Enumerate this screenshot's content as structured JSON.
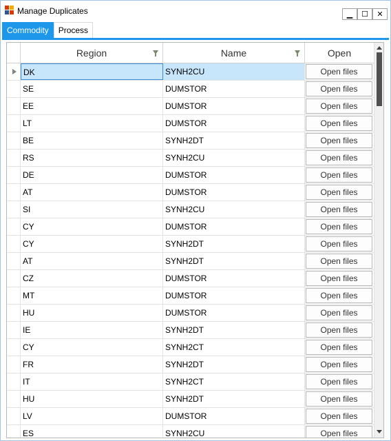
{
  "window": {
    "title": "Manage Duplicates",
    "minimize_glyph": "▁",
    "maximize_glyph": "☐",
    "close_glyph": "✕"
  },
  "tabs": [
    {
      "label": "Commodity",
      "active": true
    },
    {
      "label": "Process",
      "active": false
    }
  ],
  "colors": {
    "accent": "#1c97ea",
    "selected_row": "#c8e6fb"
  },
  "grid": {
    "columns": {
      "region": "Region",
      "name": "Name",
      "open": "Open"
    },
    "button_label": "Open files",
    "selected_index": 0,
    "rows": [
      {
        "region": "DK",
        "name": "SYNH2CU"
      },
      {
        "region": "SE",
        "name": "DUMSTOR"
      },
      {
        "region": "EE",
        "name": "DUMSTOR"
      },
      {
        "region": "LT",
        "name": "DUMSTOR"
      },
      {
        "region": "BE",
        "name": "SYNH2DT"
      },
      {
        "region": "RS",
        "name": "SYNH2CU"
      },
      {
        "region": "DE",
        "name": "DUMSTOR"
      },
      {
        "region": "AT",
        "name": "DUMSTOR"
      },
      {
        "region": "SI",
        "name": "SYNH2CU"
      },
      {
        "region": "CY",
        "name": "DUMSTOR"
      },
      {
        "region": "CY",
        "name": "SYNH2DT"
      },
      {
        "region": "AT",
        "name": "SYNH2DT"
      },
      {
        "region": "CZ",
        "name": "DUMSTOR"
      },
      {
        "region": "MT",
        "name": "DUMSTOR"
      },
      {
        "region": "HU",
        "name": "DUMSTOR"
      },
      {
        "region": "IE",
        "name": "SYNH2DT"
      },
      {
        "region": "CY",
        "name": "SYNH2CT"
      },
      {
        "region": "FR",
        "name": "SYNH2DT"
      },
      {
        "region": "IT",
        "name": "SYNH2CT"
      },
      {
        "region": "HU",
        "name": "SYNH2DT"
      },
      {
        "region": "LV",
        "name": "DUMSTOR"
      },
      {
        "region": "ES",
        "name": "SYNH2CU"
      }
    ]
  }
}
